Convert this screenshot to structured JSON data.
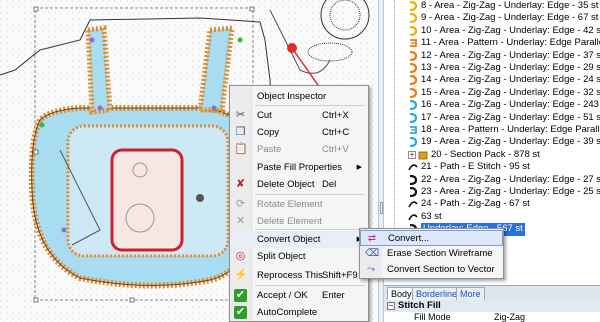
{
  "tree": {
    "items": [
      {
        "label": "8 - Area - Zig-Zag - Underlay: Edge - 35 st",
        "color": "#f0b000",
        "icon": "zigzag-area-icon"
      },
      {
        "label": "9 - Area - Zig-Zag - Underlay: Edge - 67 st",
        "color": "#f0b000",
        "icon": "zigzag-area-icon"
      },
      {
        "label": "10 - Area - Zig-Zag - Underlay: Edge - 42 st",
        "color": "#f0b000",
        "icon": "zigzag-area-icon"
      },
      {
        "label": "11 - Area - Pattern - Underlay: Edge Parallel - 46 st",
        "color": "#ee7a10",
        "icon": "pattern-area-icon"
      },
      {
        "label": "12 - Area - Zig-Zag - Underlay: Edge - 37 st",
        "color": "#ee7a10",
        "icon": "zigzag-area-icon"
      },
      {
        "label": "13 - Area - Zig-Zag - Underlay: Edge - 29 st",
        "color": "#ee7a10",
        "icon": "zigzag-area-icon"
      },
      {
        "label": "14 - Area - Zig-Zag - Underlay: Edge - 24 st",
        "color": "#ee7a10",
        "icon": "zigzag-area-icon"
      },
      {
        "label": "15 - Area - Zig-Zag - Underlay: Edge - 32 st",
        "color": "#ee7a10",
        "icon": "zigzag-area-icon"
      },
      {
        "label": "16 - Area - Zig-Zag - Underlay: Edge - 243 st",
        "color": "#2aa9e0",
        "icon": "zigzag-area-icon"
      },
      {
        "label": "17 - Area - Zig-Zag - Underlay: Edge - 51 st",
        "color": "#2aa9e0",
        "icon": "zigzag-area-icon"
      },
      {
        "label": "18 - Area - Pattern - Underlay: Edge Parallel - 46 st",
        "color": "#2aa9e0",
        "icon": "pattern-area-icon"
      },
      {
        "label": "19 - Area - Zig-Zag - Underlay: Edge - 39 st",
        "color": "#2aa9e0",
        "icon": "zigzag-area-icon"
      },
      {
        "label": "20 - Section Pack - 878 st",
        "color": "#d8a020",
        "icon": "section-pack-icon",
        "expander": "+"
      },
      {
        "label": "21 - Path - E Stitch - 95 st",
        "color": "#111111",
        "icon": "path-icon"
      },
      {
        "label": "22 - Area - Zig-Zag - Underlay: Edge - 27 st",
        "color": "#111111",
        "icon": "zigzag-area-icon"
      },
      {
        "label": "23 - Area - Zig-Zag - Underlay: Edge - 25 st",
        "color": "#111111",
        "icon": "zigzag-area-icon"
      },
      {
        "label": "24 - Path - Zig-Zag - 67 st",
        "color": "#111111",
        "icon": "path-icon"
      },
      {
        "label": "63 st",
        "color": "#111111",
        "icon": "path-icon"
      },
      {
        "label": "Underlay: Edge - 567 st",
        "color": "#111111",
        "icon": "zigzag-area-icon",
        "selected": true
      },
      {
        "label": "",
        "color": "#111111",
        "icon": "zigzag-area-icon"
      },
      {
        "label": "",
        "color": "#111111",
        "icon": "zigzag-area-icon"
      }
    ]
  },
  "context_menu": {
    "items": [
      {
        "label": "Object Inspector",
        "shortcut": "",
        "icon": "",
        "disabled": false
      },
      {
        "label": "Cut",
        "shortcut": "Ctrl+X",
        "icon": "scissors-icon",
        "glyph": "✂",
        "disabled": false
      },
      {
        "label": "Copy",
        "shortcut": "Ctrl+C",
        "icon": "copy-icon",
        "glyph": "❐",
        "disabled": false
      },
      {
        "label": "Paste",
        "shortcut": "Ctrl+V",
        "icon": "paste-icon",
        "glyph": "📋",
        "disabled": true
      },
      {
        "label": "Paste Fill Properties",
        "shortcut": "",
        "icon": "",
        "disabled": false,
        "submenu": true
      },
      {
        "label": "Delete Object",
        "shortcut": "Del",
        "icon": "delete-object-icon",
        "glyph": "✘",
        "disabled": false
      },
      {
        "label": "Rotate Element",
        "shortcut": "",
        "icon": "rotate-icon",
        "glyph": "⟳",
        "disabled": true
      },
      {
        "label": "Delete Element",
        "shortcut": "",
        "icon": "delete-element-icon",
        "glyph": "✕",
        "disabled": true
      },
      {
        "label": "Convert Object",
        "shortcut": "",
        "icon": "",
        "disabled": false,
        "submenu": true,
        "highlight": true
      },
      {
        "label": "Split Object",
        "shortcut": "",
        "icon": "split-icon",
        "glyph": "◎",
        "disabled": false
      },
      {
        "label": "Reprocess This",
        "shortcut": "Shift+F9",
        "icon": "reprocess-icon",
        "glyph": "⚡",
        "disabled": false
      },
      {
        "label": "Accept / OK",
        "shortcut": "Enter",
        "icon": "accept-icon",
        "glyph": "✔",
        "disabled": false
      },
      {
        "label": "AutoComplete",
        "shortcut": "",
        "icon": "autocomplete-icon",
        "glyph": "✔",
        "disabled": false
      }
    ]
  },
  "submenu": {
    "items": [
      {
        "label": "Convert...",
        "icon": "convert-icon",
        "glyph": "⇄",
        "highlight": true
      },
      {
        "label": "Erase Section Wireframe",
        "icon": "erase-wireframe-icon",
        "glyph": "⌫"
      },
      {
        "label": "Convert Section to Vector",
        "icon": "vector-icon",
        "glyph": "⤳"
      }
    ]
  },
  "props": {
    "tabs": [
      "Body",
      "Borderline",
      "More"
    ],
    "section": "Stitch Fill",
    "row_key": "Fill Mode",
    "row_value": "Zig-Zag"
  },
  "colors": {
    "selection": "#2a71d8",
    "fill_blue": "#a8dcf0",
    "border_orange": "#e08a2a",
    "border_red": "#d02030"
  }
}
